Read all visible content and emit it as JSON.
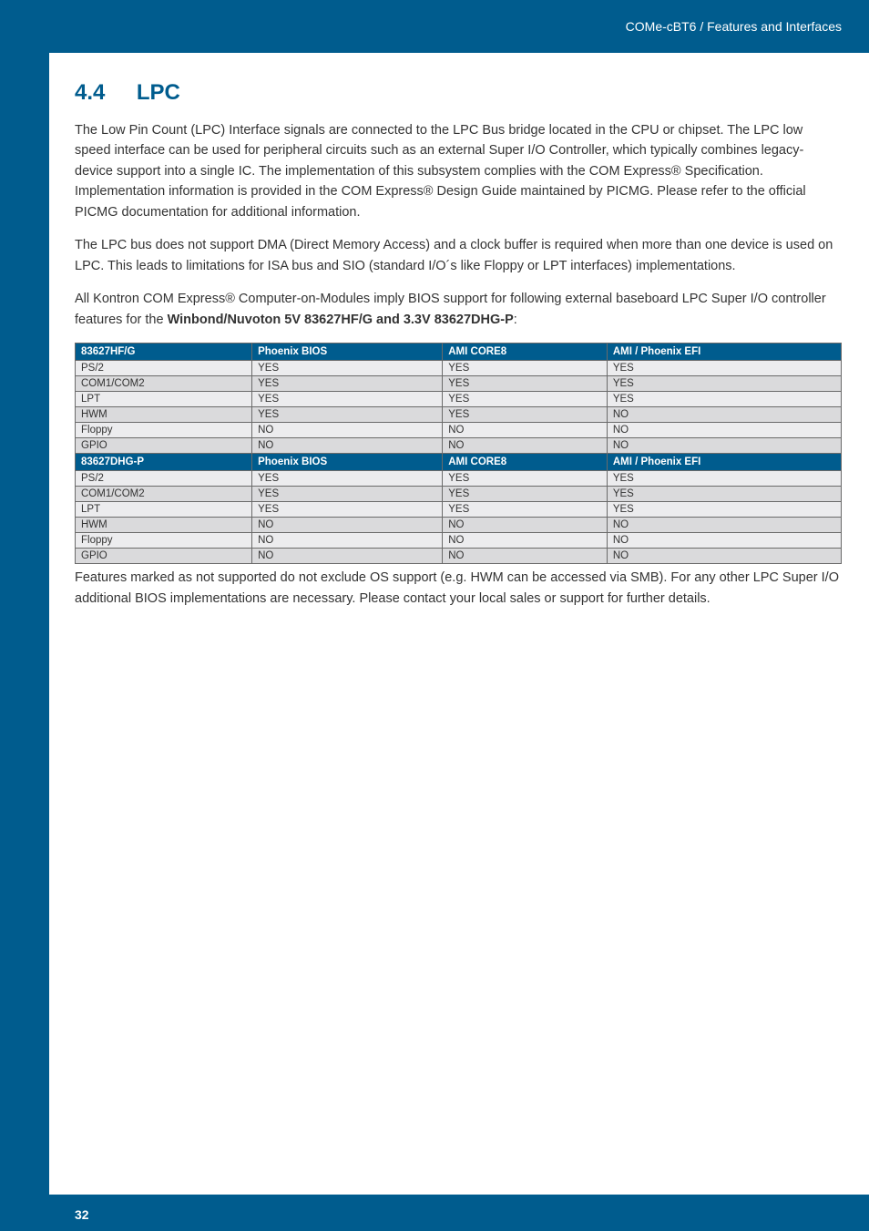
{
  "header": {
    "breadcrumb": "COMe-cBT6 / Features and Interfaces"
  },
  "section": {
    "number": "4.4",
    "title": "LPC"
  },
  "paragraphs": {
    "p1": "The Low Pin Count (LPC) Interface signals are connected to the LPC Bus bridge located in the CPU or chipset. The LPC low speed interface can be used for peripheral circuits such as an external Super I/O Controller, which typically combines legacy-device support into a single IC. The implementation of this subsystem complies with the COM Express® Specification. Implementation information is provided in the COM Express® Design Guide maintained by PICMG. Please refer to the official PICMG documentation for additional information.",
    "p2": "The LPC bus does not support DMA (Direct Memory Access) and a clock buffer is required when more than one device is used on LPC. This leads to limitations for ISA bus and SIO (standard I/O´s like Floppy or LPT interfaces) implementations.",
    "p3_pre": "All Kontron COM Express® Computer-on-Modules imply BIOS support for following external baseboard LPC Super I/O controller features for the ",
    "p3_bold": "Winbond/Nuvoton 5V 83627HF/G and 3.3V 83627DHG-P",
    "p3_post": ":",
    "note": " Features marked as not supported do not exclude OS support (e.g. HWM can be accessed via SMB). For any other LPC Super I/O additional BIOS implementations are necessary. Please contact your local sales or support for further details."
  },
  "table": {
    "header1": {
      "c0": "83627HF/G",
      "c1": "Phoenix BIOS",
      "c2": "AMI CORE8",
      "c3": "AMI / Phoenix EFI"
    },
    "rows1": [
      {
        "c0": "PS/2",
        "c1": "YES",
        "c2": "YES",
        "c3": "YES"
      },
      {
        "c0": "COM1/COM2",
        "c1": "YES",
        "c2": "YES",
        "c3": "YES"
      },
      {
        "c0": "LPT",
        "c1": "YES",
        "c2": "YES",
        "c3": "YES"
      },
      {
        "c0": "HWM",
        "c1": "YES",
        "c2": "YES",
        "c3": "NO"
      },
      {
        "c0": "Floppy",
        "c1": "NO",
        "c2": "NO",
        "c3": "NO"
      },
      {
        "c0": "GPIO",
        "c1": "NO",
        "c2": "NO",
        "c3": "NO"
      }
    ],
    "header2": {
      "c0": "83627DHG-P",
      "c1": "Phoenix BIOS",
      "c2": "AMI CORE8",
      "c3": "AMI / Phoenix EFI"
    },
    "rows2": [
      {
        "c0": "PS/2",
        "c1": "YES",
        "c2": "YES",
        "c3": "YES"
      },
      {
        "c0": "COM1/COM2",
        "c1": "YES",
        "c2": "YES",
        "c3": "YES"
      },
      {
        "c0": "LPT",
        "c1": "YES",
        "c2": "YES",
        "c3": "YES"
      },
      {
        "c0": "HWM",
        "c1": "NO",
        "c2": "NO",
        "c3": "NO"
      },
      {
        "c0": "Floppy",
        "c1": "NO",
        "c2": "NO",
        "c3": "NO"
      },
      {
        "c0": "GPIO",
        "c1": "NO",
        "c2": "NO",
        "c3": "NO"
      }
    ]
  },
  "footer": {
    "page_number": "32"
  }
}
